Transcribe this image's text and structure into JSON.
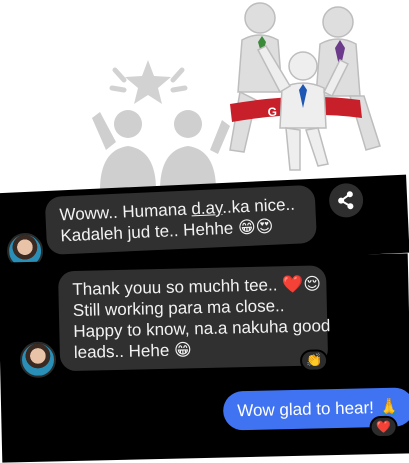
{
  "header_art": {
    "goal_banner": "GOAL",
    "colors": {
      "figure": "#cccccc",
      "goal_ribbon": "#c8202a",
      "tie_blue": "#1e56b3",
      "tie_green": "#3a8a3a",
      "tie_purple": "#6b3a8a"
    },
    "icons": [
      "celebrating-team-icon",
      "star-icon",
      "finish-line-runners-illustration"
    ]
  },
  "chat_top": {
    "message_lines": [
      "Woww.. Humana ",
      "d.ay",
      "..ka nice..",
      "Kadaleh jud te.. Hehhe 😁😍"
    ],
    "share_icon": "share-icon"
  },
  "chat_bottom": {
    "incoming_lines": [
      "Thank youu so muchh tee.. ❤️😌",
      "Still working para ma close..",
      "Happy to know, na.a nakuha good",
      "leads.. Hehe 😁"
    ],
    "incoming_reaction": "👏",
    "outgoing_text": "Wow glad to hear! 🙏",
    "outgoing_reaction": "❤️"
  },
  "colors": {
    "chat_bg": "#000000",
    "incoming_bubble": "#303030",
    "outgoing_bubble": "#3f73f2"
  }
}
